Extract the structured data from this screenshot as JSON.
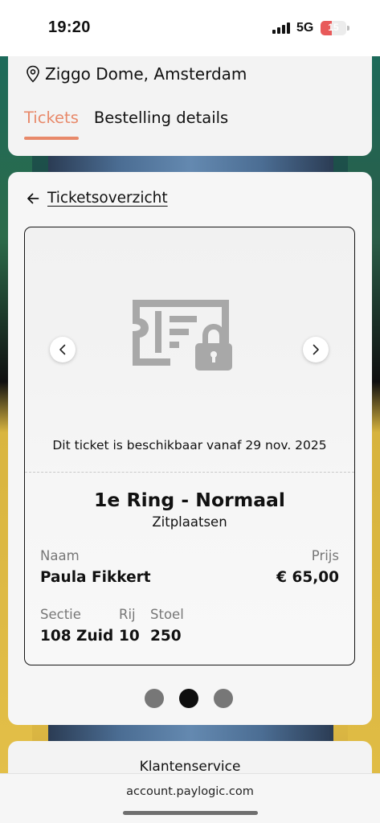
{
  "status_bar": {
    "time": "19:20",
    "network": "5G",
    "battery_level": "15",
    "battery_fraction": 0.15
  },
  "event": {
    "venue": "Ziggo Dome, Amsterdam"
  },
  "tabs": [
    {
      "label": "Tickets",
      "active": true
    },
    {
      "label": "Bestelling details",
      "active": false
    }
  ],
  "ticket_panel": {
    "back_label": "Ticketsoverzicht",
    "availability_text": "Dit ticket is beschikbaar vanaf 29 nov. 2025",
    "ticket_name": "1e Ring - Normaal",
    "ticket_type": "Zitplaatsen",
    "name_label": "Naam",
    "name_value": "Paula Fikkert",
    "price_label": "Prijs",
    "price_value": "€ 65,00",
    "section_label": "Sectie",
    "section_value": "108 Zuid",
    "row_label": "Rij",
    "row_value": "10",
    "seat_label": "Stoel",
    "seat_value": "250"
  },
  "pagination": {
    "count": 3,
    "active_index": 1
  },
  "footer": {
    "customer_service": "Klantenservice",
    "url": "account.paylogic.com"
  },
  "colors": {
    "accent": "#e8896a",
    "card_bg": "#f3f3f3",
    "battery_low": "#e85a5a",
    "icon_gray": "#a8a8a8"
  }
}
